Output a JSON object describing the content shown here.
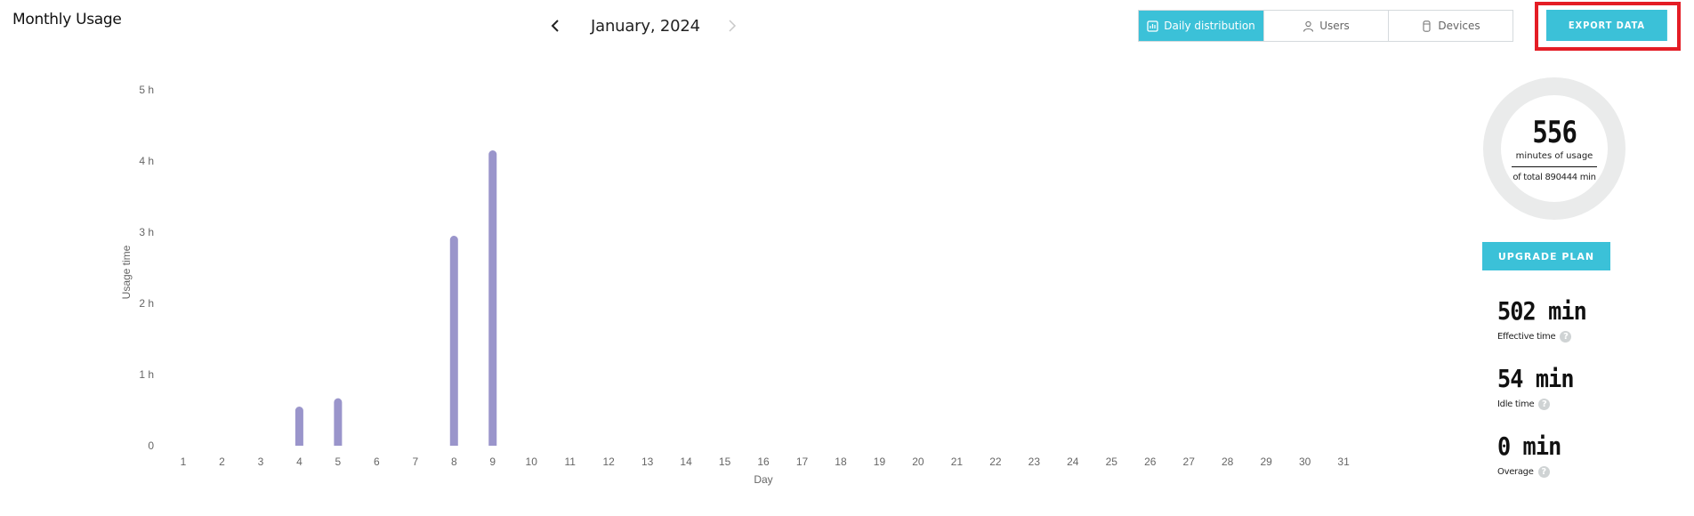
{
  "header": {
    "title": "Monthly Usage",
    "month": "January, 2024",
    "prev_icon": "chevron-left-icon",
    "next_icon": "chevron-right-icon",
    "next_disabled": true
  },
  "view_tabs": [
    {
      "label": "Daily distribution",
      "icon": "bar-chart-icon",
      "active": true
    },
    {
      "label": "Users",
      "icon": "user-icon",
      "active": false
    },
    {
      "label": "Devices",
      "icon": "device-icon",
      "active": false
    }
  ],
  "export_button": {
    "label": "EXPORT DATA",
    "highlighted": true
  },
  "colors": {
    "accent": "#3bc1d8",
    "bar": "#9a95cb",
    "highlight": "#e41d25",
    "ring": "#eaebeb"
  },
  "usage_summary": {
    "total_minutes": "556",
    "unit_label": "minutes of usage",
    "of_total_label": "of total 890444 min",
    "upgrade_label": "UPGRADE PLAN"
  },
  "stats": [
    {
      "value": "502 min",
      "label": "Effective time",
      "help_icon": "question-circle-icon"
    },
    {
      "value": "54 min",
      "label": "Idle time",
      "help_icon": "question-circle-icon"
    },
    {
      "value": "0 min",
      "label": "Overage",
      "help_icon": "question-circle-icon"
    }
  ],
  "chart_data": {
    "type": "bar",
    "title": "",
    "xlabel": "Day",
    "ylabel": "Usage time",
    "categories": [
      "1",
      "2",
      "3",
      "4",
      "5",
      "6",
      "7",
      "8",
      "9",
      "10",
      "11",
      "12",
      "13",
      "14",
      "15",
      "16",
      "17",
      "18",
      "19",
      "20",
      "21",
      "22",
      "23",
      "24",
      "25",
      "26",
      "27",
      "28",
      "29",
      "30",
      "31"
    ],
    "values_minutes": [
      0,
      0,
      0,
      33,
      40,
      0,
      0,
      177,
      249,
      0,
      0,
      0,
      0,
      0,
      0,
      0,
      0,
      0,
      0,
      0,
      0,
      0,
      0,
      0,
      0,
      0,
      0,
      0,
      0,
      0,
      0
    ],
    "y_ticks": [
      "0",
      "1 h",
      "2 h",
      "3 h",
      "4 h",
      "5 h"
    ],
    "y_tick_values_hours": [
      0,
      1,
      2,
      3,
      4,
      5
    ],
    "ylim_hours": [
      0,
      5
    ],
    "grid": false,
    "legend": "none"
  }
}
